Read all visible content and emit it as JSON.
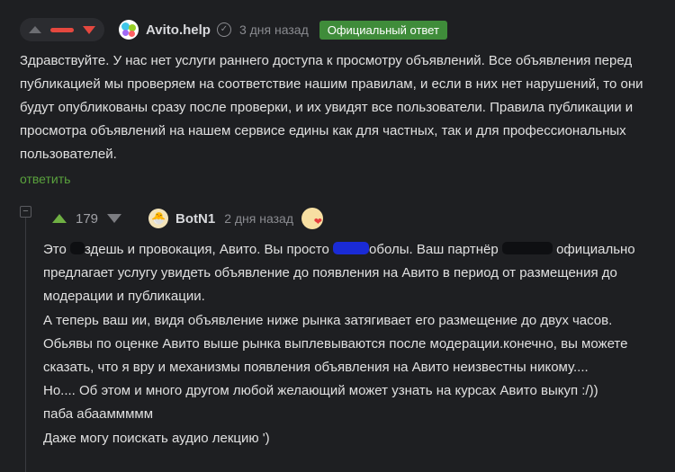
{
  "comment1": {
    "author": "Avito.help",
    "verified_icon": "check-icon",
    "time": "3 дня назад",
    "badge": "Официальный ответ",
    "text": "Здравствуйте. У нас нет услуги раннего доступа к просмотру объявлений. Все объявления перед публикацией мы проверяем на соответствие нашим правилам, и если в них нет нарушений, то они будут опубликованы сразу после проверки, и их увидят все пользователи. Правила публикации и просмотра объявлений на нашем сервисе едины как для частных, так и для профессиональных пользователей.",
    "reply_label": "ответить",
    "colors": {
      "downvote": "#e5483f",
      "badge": "#3f8c3a",
      "reply": "#5aa23d"
    }
  },
  "comment2": {
    "collapse_label": "−",
    "score": "179",
    "author": "BotN1",
    "time": "2 дня назад",
    "lines": {
      "l1a": "Это",
      "l1b": "здешь и провокация, Авито. Вы просто",
      "l1c": "оболы. Ваш партнёр",
      "l1d": "официально",
      "l2": "предлагает услугу увидеть объявление до появления на Авито в период от размещения до",
      "l3": "модерации и публикации.",
      "l4": "А теперь ваш ии, видя объявление ниже рынка затягивает его размещение до двух часов.",
      "l5": "Обьявы по оценке Авито выше рынка выплевываются после модерации.конечно, вы можете",
      "l6": "сказать, что я вру и механизмы появления объявления на Авито неизвестны никому....",
      "l7": "Но.... Об этом и много другом любой желающий может узнать на курсах Авито выкуп :/))",
      "l8": "паба абааммммм",
      "l9": "Даже могу поискать аудио лекцию ')"
    },
    "colors": {
      "upvote": "#6fb043",
      "redaction_blue": "#1a2bd6"
    }
  }
}
